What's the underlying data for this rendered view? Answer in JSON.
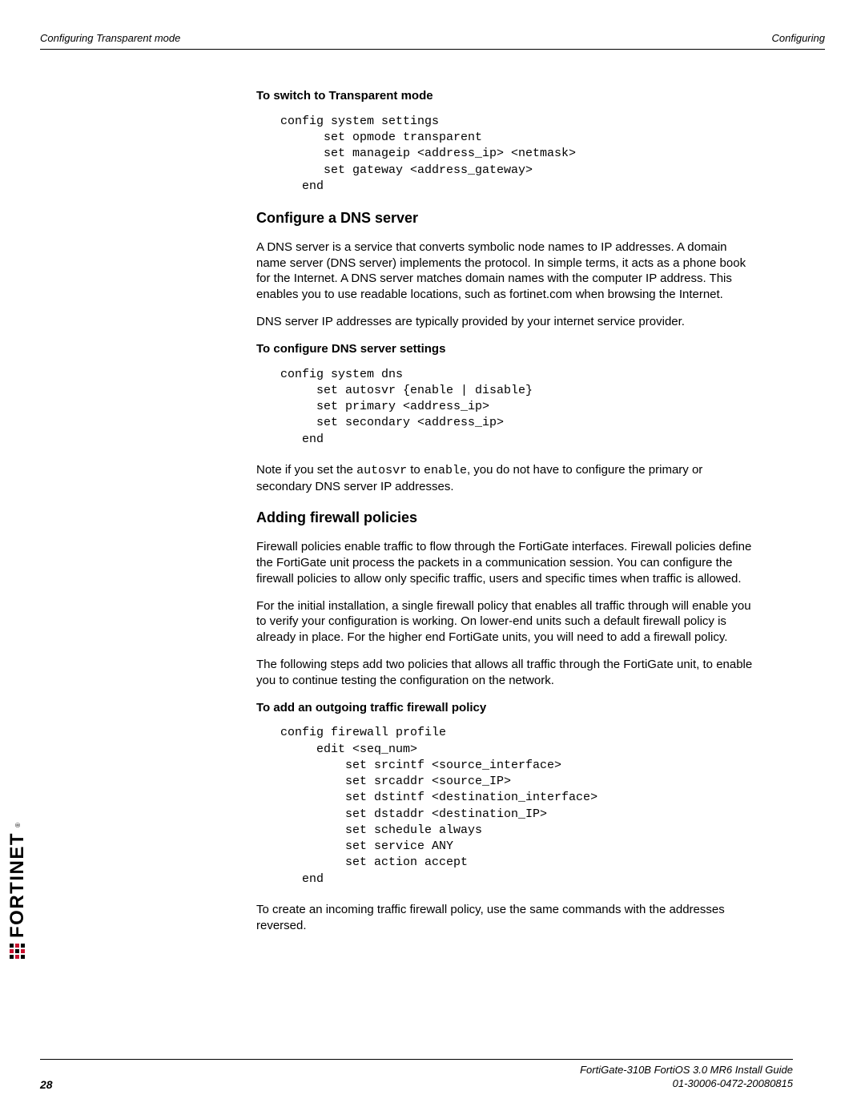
{
  "header": {
    "left": "Configuring Transparent mode",
    "right": "Configuring"
  },
  "sections": {
    "proc1": {
      "title": "To switch to Transparent mode",
      "code": "config system settings\n      set opmode transparent\n      set manageip <address_ip> <netmask>\n      set gateway <address_gateway>\n   end"
    },
    "dns": {
      "heading": "Configure a DNS server",
      "para1": "A DNS server is a service that converts symbolic node names to IP addresses. A domain name server (DNS server) implements the protocol. In simple terms, it acts as a phone book for the Internet. A DNS server matches domain names with the computer IP address. This enables you to use readable locations, such as fortinet.com when browsing the Internet.",
      "para2": "DNS server IP addresses are typically provided by your internet service provider.",
      "proc_title": "To configure DNS server settings",
      "code": "config system dns\n     set autosvr {enable | disable}\n     set primary <address_ip>\n     set secondary <address_ip>\n   end",
      "note_a": "Note if you set the ",
      "note_code1": "autosvr",
      "note_b": " to ",
      "note_code2": "enable",
      "note_c": ", you do not have to configure the primary or secondary DNS server IP addresses."
    },
    "firewall": {
      "heading": "Adding firewall policies",
      "para1": "Firewall policies enable traffic to flow through the FortiGate interfaces. Firewall policies define the FortiGate unit process the packets in a communication session. You can configure the firewall policies to allow only specific traffic, users and specific times when traffic is allowed.",
      "para2": "For the initial installation, a single firewall policy that enables all traffic through will enable you to verify your configuration is working. On lower-end units such a default firewall policy is already in place. For the higher end FortiGate units, you will need to add a firewall policy.",
      "para3": "The following steps add two policies that allows all traffic through the FortiGate unit, to enable you to continue testing the configuration on the network.",
      "proc_title": "To add an outgoing traffic firewall policy",
      "code": "config firewall profile\n     edit <seq_num>\n         set srcintf <source_interface>\n         set srcaddr <source_IP>\n         set dstintf <destination_interface>\n         set dstaddr <destination_IP>\n         set schedule always\n         set service ANY\n         set action accept\n   end",
      "para4": "To create an incoming traffic firewall policy, use the same commands with the addresses reversed."
    }
  },
  "footer": {
    "page_num": "28",
    "guide": "FortiGate-310B FortiOS 3.0 MR6 Install Guide",
    "doc_id": "01-30006-0472-20080815"
  },
  "logo": {
    "text": "FORTINET",
    "reg": "®"
  }
}
